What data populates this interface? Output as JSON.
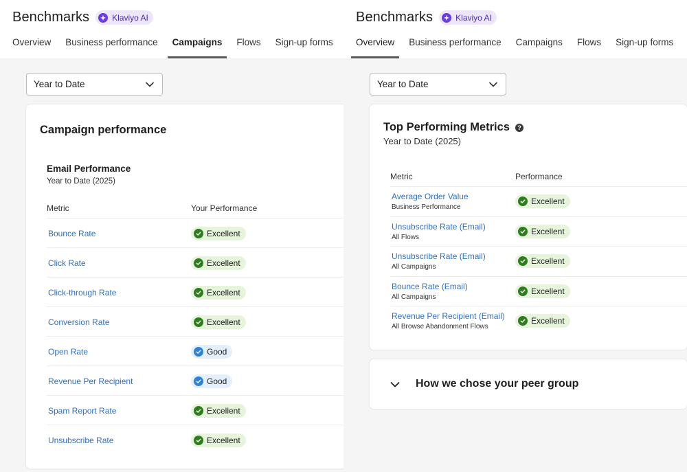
{
  "left": {
    "header": {
      "title": "Benchmarks",
      "ai_badge": "Klaviyo AI"
    },
    "tabs": [
      {
        "label": "Overview"
      },
      {
        "label": "Business performance"
      },
      {
        "label": "Campaigns"
      },
      {
        "label": "Flows"
      },
      {
        "label": "Sign-up forms"
      }
    ],
    "active_tab": "Campaigns",
    "date_filter": {
      "value": "Year to Date"
    },
    "card": {
      "title": "Campaign performance",
      "section_title": "Email Performance",
      "section_subtitle": "Year to Date (2025)",
      "columns": {
        "metric": "Metric",
        "performance": "Your Performance"
      },
      "rows": [
        {
          "metric": "Bounce Rate",
          "performance": "Excellent"
        },
        {
          "metric": "Click Rate",
          "performance": "Excellent"
        },
        {
          "metric": "Click-through Rate",
          "performance": "Excellent"
        },
        {
          "metric": "Conversion Rate",
          "performance": "Excellent"
        },
        {
          "metric": "Open Rate",
          "performance": "Good"
        },
        {
          "metric": "Revenue Per Recipient",
          "performance": "Good"
        },
        {
          "metric": "Spam Report Rate",
          "performance": "Excellent"
        },
        {
          "metric": "Unsubscribe Rate",
          "performance": "Excellent"
        }
      ]
    }
  },
  "right": {
    "header": {
      "title": "Benchmarks",
      "ai_badge": "Klaviyo AI"
    },
    "tabs": [
      {
        "label": "Overview"
      },
      {
        "label": "Business performance"
      },
      {
        "label": "Campaigns"
      },
      {
        "label": "Flows"
      },
      {
        "label": "Sign-up forms"
      }
    ],
    "active_tab": "Overview",
    "date_filter": {
      "value": "Year to Date"
    },
    "top_card": {
      "title": "Top Performing Metrics",
      "subtitle": "Year to Date (2025)",
      "columns": {
        "metric": "Metric",
        "performance": "Performance"
      },
      "rows": [
        {
          "metric": "Average Order Value",
          "source": "Business Performance",
          "performance": "Excellent"
        },
        {
          "metric": "Unsubscribe Rate (Email)",
          "source": "All Flows",
          "performance": "Excellent"
        },
        {
          "metric": "Unsubscribe Rate (Email)",
          "source": "All Campaigns",
          "performance": "Excellent"
        },
        {
          "metric": "Bounce Rate (Email)",
          "source": "All Campaigns",
          "performance": "Excellent"
        },
        {
          "metric": "Revenue Per Recipient (Email)",
          "source": "All Browse Abandonment Flows",
          "performance": "Excellent"
        }
      ]
    },
    "peer_card": {
      "label": "How we chose your peer group"
    }
  },
  "icons": {
    "ai": "sparkle-icon",
    "dropdown": "chevron-down-icon",
    "excellent": "check-circle-icon",
    "good": "check-circle-icon",
    "help": "question-circle-icon",
    "expand": "chevron-down-icon"
  },
  "colors": {
    "link": "#2f6fbf",
    "excellent_bg": "#e6f4dc",
    "excellent_icon": "#2f7d1f",
    "good_bg": "#e3f0fb",
    "good_icon": "#2f82d6",
    "ai_badge_bg": "#ede6fb",
    "ai_icon": "#6b3ddb"
  }
}
